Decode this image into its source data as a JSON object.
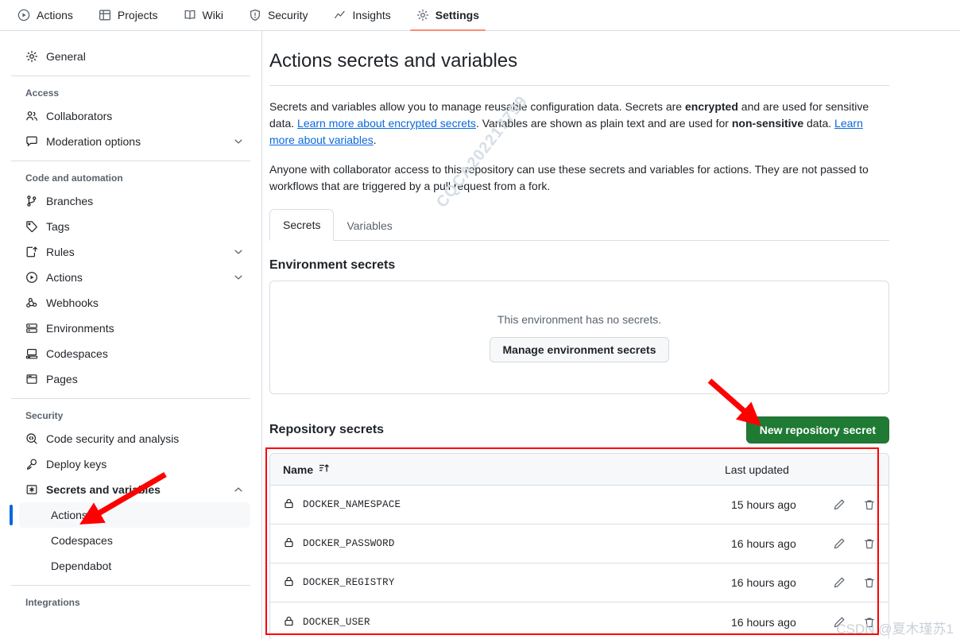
{
  "topnav": {
    "items": [
      {
        "label": "Actions",
        "icon": "play-circle-icon",
        "active": false
      },
      {
        "label": "Projects",
        "icon": "table-icon",
        "active": false
      },
      {
        "label": "Wiki",
        "icon": "book-icon",
        "active": false
      },
      {
        "label": "Security",
        "icon": "shield-icon",
        "active": false
      },
      {
        "label": "Insights",
        "icon": "graph-icon",
        "active": false
      },
      {
        "label": "Settings",
        "icon": "gear-icon",
        "active": true
      }
    ]
  },
  "sidebar": {
    "general": {
      "label": "General",
      "icon": "gear-icon"
    },
    "groups": [
      {
        "title": "Access",
        "items": [
          {
            "label": "Collaborators",
            "icon": "people-icon",
            "chevron": false
          },
          {
            "label": "Moderation options",
            "icon": "comment-icon",
            "chevron": true
          }
        ]
      },
      {
        "title": "Code and automation",
        "items": [
          {
            "label": "Branches",
            "icon": "branch-icon",
            "chevron": false
          },
          {
            "label": "Tags",
            "icon": "tag-icon",
            "chevron": false
          },
          {
            "label": "Rules",
            "icon": "rules-icon",
            "chevron": true
          },
          {
            "label": "Actions",
            "icon": "play-circle-icon",
            "chevron": true
          },
          {
            "label": "Webhooks",
            "icon": "webhook-icon",
            "chevron": false
          },
          {
            "label": "Environments",
            "icon": "server-icon",
            "chevron": false
          },
          {
            "label": "Codespaces",
            "icon": "codespaces-icon",
            "chevron": false
          },
          {
            "label": "Pages",
            "icon": "browser-icon",
            "chevron": false
          }
        ]
      },
      {
        "title": "Security",
        "items": [
          {
            "label": "Code security and analysis",
            "icon": "codescan-icon",
            "chevron": false
          },
          {
            "label": "Deploy keys",
            "icon": "key-icon",
            "chevron": false
          },
          {
            "label": "Secrets and variables",
            "icon": "asterisk-key-icon",
            "chevron": true,
            "expanded": true,
            "bold": true
          }
        ],
        "subitems": [
          {
            "label": "Actions",
            "active": true
          },
          {
            "label": "Codespaces",
            "active": false
          },
          {
            "label": "Dependabot",
            "active": false
          }
        ]
      }
    ],
    "last_group_title": "Integrations"
  },
  "main": {
    "title": "Actions secrets and variables",
    "paragraph1": {
      "part1": "Secrets and variables allow you to manage reusable configuration data. Secrets are ",
      "bold1": "encrypted",
      "part2": " and are used for sensitive data. ",
      "link1": "Learn more about encrypted secrets",
      "part3": ". Variables are shown as plain text and are used for ",
      "bold2": "non-sensitive",
      "part4": " data. ",
      "link2": "Learn more about variables",
      "part5": "."
    },
    "paragraph2": "Anyone with collaborator access to this repository can use these secrets and variables for actions. They are not passed to workflows that are triggered by a pull request from a fork.",
    "tabs": [
      {
        "label": "Secrets",
        "active": true
      },
      {
        "label": "Variables",
        "active": false
      }
    ],
    "environment_secrets": {
      "heading": "Environment secrets",
      "empty_text": "This environment has no secrets.",
      "manage_button": "Manage environment secrets"
    },
    "repository_secrets": {
      "heading": "Repository secrets",
      "new_button": "New repository secret",
      "columns": {
        "name": "Name",
        "sort_icon": "sort-asc-icon",
        "last_updated": "Last updated"
      },
      "rows": [
        {
          "icon": "lock-icon",
          "name": "DOCKER_NAMESPACE",
          "last_updated": "15 hours ago",
          "edit_icon": "pencil-icon",
          "delete_icon": "trash-icon"
        },
        {
          "icon": "lock-icon",
          "name": "DOCKER_PASSWORD",
          "last_updated": "16 hours ago",
          "edit_icon": "pencil-icon",
          "delete_icon": "trash-icon"
        },
        {
          "icon": "lock-icon",
          "name": "DOCKER_REGISTRY",
          "last_updated": "16 hours ago",
          "edit_icon": "pencil-icon",
          "delete_icon": "trash-icon"
        },
        {
          "icon": "lock-icon",
          "name": "DOCKER_USER",
          "last_updated": "16 hours ago",
          "edit_icon": "pencil-icon",
          "delete_icon": "trash-icon"
        }
      ]
    }
  },
  "watermarks": {
    "center": "CQCA202217799",
    "corner": "CSDN @夏木瑾苏1"
  },
  "colors": {
    "accent_green": "#1f7a34",
    "accent_blue": "#0969da",
    "annotation_red": "#ff0000",
    "tab_underline": "#fd8c73",
    "border": "#d8dee4"
  }
}
